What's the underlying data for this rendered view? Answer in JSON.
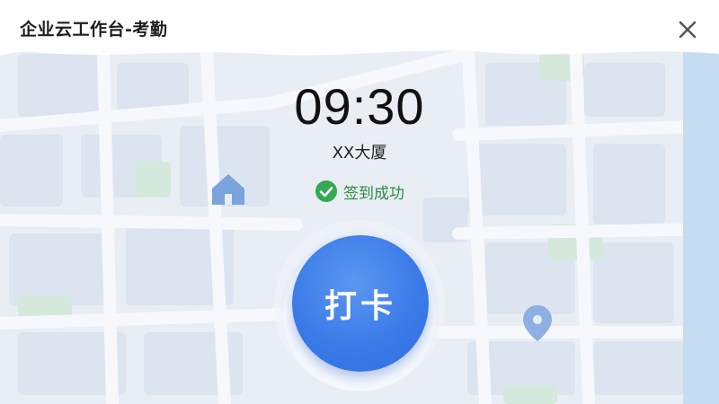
{
  "header": {
    "title": "企业云工作台-考勤"
  },
  "clock": {
    "time": "09:30"
  },
  "location": {
    "name": "XX大厦"
  },
  "status": {
    "text": "签到成功",
    "color": "#2e8b3e"
  },
  "punch_button": {
    "label": "打卡",
    "color": "#3b7be8"
  },
  "icons": [
    "close-icon",
    "check-circle-icon",
    "home-icon",
    "map-pin-icon"
  ]
}
